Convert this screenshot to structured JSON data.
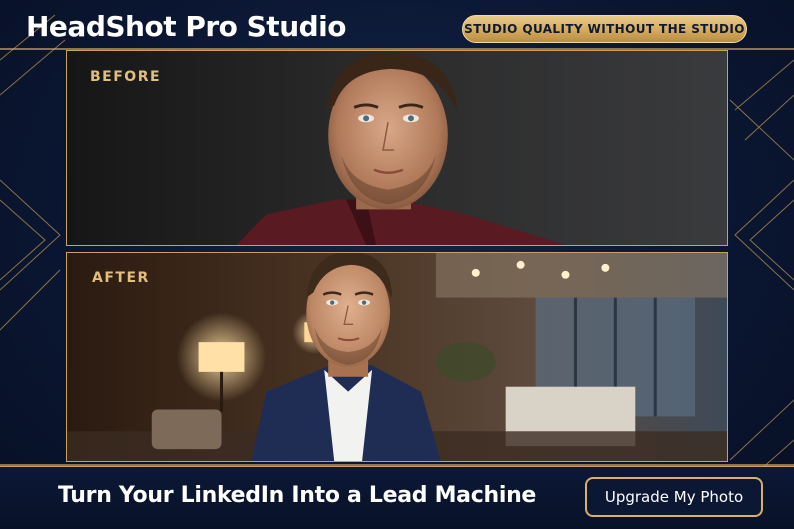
{
  "app_title": "HeadShot Pro Studio",
  "tagline": "STUDIO QUALITY WITHOUT THE STUDIO",
  "panels": {
    "before": {
      "label": "BEFORE"
    },
    "after": {
      "label": "AFTER"
    }
  },
  "footer": {
    "headline": "Turn Your LinkedIn Into a Lead Machine",
    "cta_label": "Upgrade My Photo"
  },
  "colors": {
    "background": "#0b1733",
    "gold_accent": "#c9a25f",
    "badge_gold": "#d4aa5e",
    "label_gold": "#e3bf7c",
    "text_white": "#ffffff"
  }
}
